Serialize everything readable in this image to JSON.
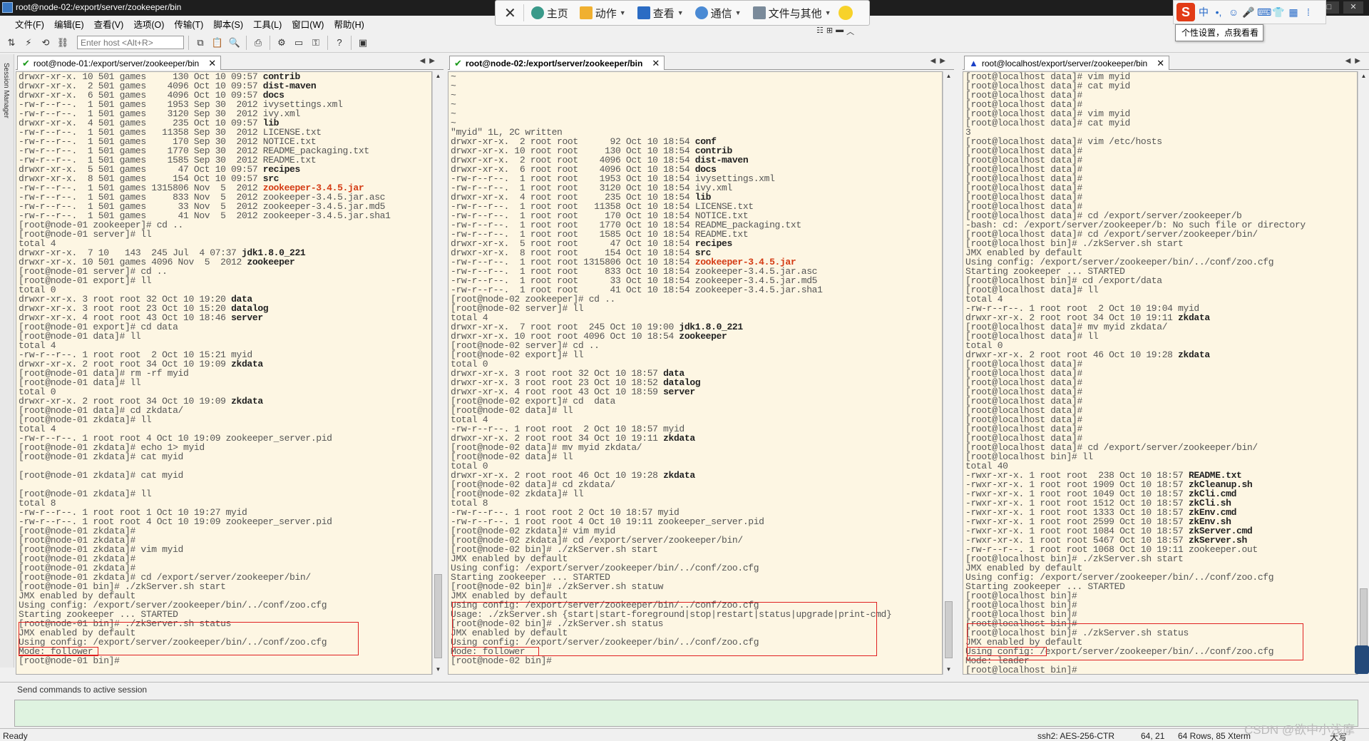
{
  "window": {
    "title": "root@node-02:/export/server/zookeeper/bin",
    "controls": [
      "—",
      "□",
      "✕"
    ]
  },
  "float_toolbar": {
    "close": "✕",
    "items": [
      {
        "label": "主页",
        "caret": false
      },
      {
        "label": "动作",
        "caret": true
      },
      {
        "label": "查看",
        "caret": true
      },
      {
        "label": "通信",
        "caret": true
      },
      {
        "label": "文件与其他",
        "caret": true
      }
    ],
    "mini_controls": [
      "☷",
      "⊞",
      "▬",
      "︿"
    ]
  },
  "ime": {
    "logo": "S",
    "lang": "中",
    "icons": [
      "•,",
      "☺",
      "🎤",
      "⌨",
      "👕",
      "▦",
      "⁞"
    ],
    "tooltip": "个性设置，点我看看"
  },
  "menu": [
    "文件(F)",
    "编辑(E)",
    "查看(V)",
    "选项(O)",
    "传输(T)",
    "脚本(S)",
    "工具(L)",
    "窗口(W)",
    "帮助(H)"
  ],
  "toolbar": {
    "host_placeholder": "Enter host <Alt+R>"
  },
  "session_manager": "Session Manager",
  "panes": [
    {
      "tab_label": "root@node-01:/export/server/zookeeper/bin",
      "tab_status": "connected",
      "lines": [
        "drwxr-xr-x. 10 501 games     130 Oct 10 09:57 [[contrib]]",
        "drwxr-xr-x.  2 501 games    4096 Oct 10 09:57 [[dist-maven]]",
        "drwxr-xr-x.  6 501 games    4096 Oct 10 09:57 [[docs]]",
        "-rw-r--r--.  1 501 games    1953 Sep 30  2012 ivysettings.xml",
        "-rw-r--r--.  1 501 games    3120 Sep 30  2012 ivy.xml",
        "drwxr-xr-x.  4 501 games     235 Oct 10 09:57 [[lib]]",
        "-rw-r--r--.  1 501 games   11358 Sep 30  2012 LICENSE.txt",
        "-rw-r--r--.  1 501 games     170 Sep 30  2012 NOTICE.txt",
        "-rw-r--r--.  1 501 games    1770 Sep 30  2012 README_packaging.txt",
        "-rw-r--r--.  1 501 games    1585 Sep 30  2012 README.txt",
        "drwxr-xr-x.  5 501 games      47 Oct 10 09:57 [[recipes]]",
        "drwxr-xr-x.  8 501 games     154 Oct 10 09:57 [[src]]",
        "-rw-r--r--.  1 501 games 1315806 Nov  5  2012 {{zookeeper-3.4.5.jar}}",
        "-rw-r--r--.  1 501 games     833 Nov  5  2012 zookeeper-3.4.5.jar.asc",
        "-rw-r--r--.  1 501 games      33 Nov  5  2012 zookeeper-3.4.5.jar.md5",
        "-rw-r--r--.  1 501 games      41 Nov  5  2012 zookeeper-3.4.5.jar.sha1",
        "[root@node-01 zookeeper]# cd ..",
        "[root@node-01 server]# ll",
        "total 4",
        "drwxr-xr-x.  7 10   143  245 Jul  4 07:37 [[jdk1.8.0_221]]",
        "drwxr-xr-x. 10 501 games 4096 Nov  5  2012 [[zookeeper]]",
        "[root@node-01 server]# cd ..",
        "[root@node-01 export]# ll",
        "total 0",
        "drwxr-xr-x. 3 root root 32 Oct 10 19:20 [[data]]",
        "drwxr-xr-x. 3 root root 23 Oct 10 15:20 [[datalog]]",
        "drwxr-xr-x. 4 root root 43 Oct 10 18:46 [[server]]",
        "[root@node-01 export]# cd data",
        "[root@node-01 data]# ll",
        "total 4",
        "-rw-r--r--. 1 root root  2 Oct 10 15:21 myid",
        "drwxr-xr-x. 2 root root 34 Oct 10 19:09 [[zkdata]]",
        "[root@node-01 data]# rm -rf myid",
        "[root@node-01 data]# ll",
        "total 0",
        "drwxr-xr-x. 2 root root 34 Oct 10 19:09 [[zkdata]]",
        "[root@node-01 data]# cd zkdata/",
        "[root@node-01 zkdata]# ll",
        "total 4",
        "-rw-r--r--. 1 root root 4 Oct 10 19:09 zookeeper_server.pid",
        "[root@node-01 zkdata]# echo 1> myid",
        "[root@node-01 zkdata]# cat myid",
        "",
        "[root@node-01 zkdata]# cat myid",
        "",
        "[root@node-01 zkdata]# ll",
        "total 8",
        "-rw-r--r--. 1 root root 1 Oct 10 19:27 myid",
        "-rw-r--r--. 1 root root 4 Oct 10 19:09 zookeeper_server.pid",
        "[root@node-01 zkdata]#",
        "[root@node-01 zkdata]#",
        "[root@node-01 zkdata]# vim myid",
        "[root@node-01 zkdata]#",
        "[root@node-01 zkdata]#",
        "[root@node-01 zkdata]# cd /export/server/zookeeper/bin/",
        "[root@node-01 bin]# ./zkServer.sh start",
        "JMX enabled by default",
        "Using config: /export/server/zookeeper/bin/../conf/zoo.cfg",
        "Starting zookeeper ... STARTED",
        "[root@node-01 bin]# ./zkServer.sh status",
        "JMX enabled by default",
        "Using config: /export/server/zookeeper/bin/../conf/zoo.cfg",
        "Mode: follower",
        "[root@node-01 bin]#"
      ]
    },
    {
      "tab_label": "root@node-02:/export/server/zookeeper/bin",
      "tab_status": "connected",
      "lines": [
        "~",
        "~",
        "~",
        "~",
        "~",
        "~",
        "\"myid\" 1L, 2C written",
        "drwxr-xr-x.  2 root root      92 Oct 10 18:54 [[conf]]",
        "drwxr-xr-x. 10 root root     130 Oct 10 18:54 [[contrib]]",
        "drwxr-xr-x.  2 root root    4096 Oct 10 18:54 [[dist-maven]]",
        "drwxr-xr-x.  6 root root    4096 Oct 10 18:54 [[docs]]",
        "-rw-r--r--.  1 root root    1953 Oct 10 18:54 ivysettings.xml",
        "-rw-r--r--.  1 root root    3120 Oct 10 18:54 ivy.xml",
        "drwxr-xr-x.  4 root root     235 Oct 10 18:54 [[lib]]",
        "-rw-r--r--.  1 root root   11358 Oct 10 18:54 LICENSE.txt",
        "-rw-r--r--.  1 root root     170 Oct 10 18:54 NOTICE.txt",
        "-rw-r--r--.  1 root root    1770 Oct 10 18:54 README_packaging.txt",
        "-rw-r--r--.  1 root root    1585 Oct 10 18:54 README.txt",
        "drwxr-xr-x.  5 root root      47 Oct 10 18:54 [[recipes]]",
        "drwxr-xr-x.  8 root root     154 Oct 10 18:54 [[src]]",
        "-rw-r--r--.  1 root root 1315806 Oct 10 18:54 {{zookeeper-3.4.5.jar}}",
        "-rw-r--r--.  1 root root     833 Oct 10 18:54 zookeeper-3.4.5.jar.asc",
        "-rw-r--r--.  1 root root      33 Oct 10 18:54 zookeeper-3.4.5.jar.md5",
        "-rw-r--r--.  1 root root      41 Oct 10 18:54 zookeeper-3.4.5.jar.sha1",
        "[root@node-02 zookeeper]# cd ..",
        "[root@node-02 server]# ll",
        "total 4",
        "drwxr-xr-x.  7 root root  245 Oct 10 19:00 [[jdk1.8.0_221]]",
        "drwxr-xr-x. 10 root root 4096 Oct 10 18:54 [[zookeeper]]",
        "[root@node-02 server]# cd ..",
        "[root@node-02 export]# ll",
        "total 0",
        "drwxr-xr-x. 3 root root 32 Oct 10 18:57 [[data]]",
        "drwxr-xr-x. 3 root root 23 Oct 10 18:52 [[datalog]]",
        "drwxr-xr-x. 4 root root 43 Oct 10 18:59 [[server]]",
        "[root@node-02 export]# cd  data",
        "[root@node-02 data]# ll",
        "total 4",
        "-rw-r--r--. 1 root root  2 Oct 10 18:57 myid",
        "drwxr-xr-x. 2 root root 34 Oct 10 19:11 [[zkdata]]",
        "[root@node-02 data]# mv myid zkdata/",
        "[root@node-02 data]# ll",
        "total 0",
        "drwxr-xr-x. 2 root root 46 Oct 10 19:28 [[zkdata]]",
        "[root@node-02 data]# cd zkdata/",
        "[root@node-02 zkdata]# ll",
        "total 8",
        "-rw-r--r--. 1 root root 2 Oct 10 18:57 myid",
        "-rw-r--r--. 1 root root 4 Oct 10 19:11 zookeeper_server.pid",
        "[root@node-02 zkdata]# vim myid",
        "[root@node-02 zkdata]# cd /export/server/zookeeper/bin/",
        "[root@node-02 bin]# ./zkServer.sh start",
        "JMX enabled by default",
        "Using config: /export/server/zookeeper/bin/../conf/zoo.cfg",
        "Starting zookeeper ... STARTED",
        "[root@node-02 bin]# ./zkServer.sh statuw",
        "JMX enabled by default",
        "Using config: /export/server/zookeeper/bin/../conf/zoo.cfg",
        "Usage: ./zkServer.sh {start|start-foreground|stop|restart|status|upgrade|print-cmd}",
        "[root@node-02 bin]# ./zkServer.sh status",
        "JMX enabled by default",
        "Using config: /export/server/zookeeper/bin/../conf/zoo.cfg",
        "Mode: follower",
        "[root@node-02 bin]#"
      ]
    },
    {
      "tab_label": "root@localhost/export/server/zookeeper/bin",
      "tab_status": "warning",
      "lines": [
        "[root@localhost data]# vim myid",
        "[root@localhost data]# cat myid",
        "[root@localhost data]#",
        "[root@localhost data]#",
        "[root@localhost data]# vim myid",
        "[root@localhost data]# cat myid",
        "3",
        "[root@localhost data]# vim /etc/hosts",
        "[root@localhost data]#",
        "[root@localhost data]#",
        "[root@localhost data]#",
        "[root@localhost data]#",
        "[root@localhost data]#",
        "[root@localhost data]#",
        "[root@localhost data]#",
        "[root@localhost data]# cd /export/server/zookeeper/b",
        "-bash: cd: /export/server/zookeeper/b: No such file or directory",
        "[root@localhost data]# cd /export/server/zookeeper/bin/",
        "[root@localhost bin]# ./zkServer.sh start",
        "JMX enabled by default",
        "Using config: /export/server/zookeeper/bin/../conf/zoo.cfg",
        "Starting zookeeper ... STARTED",
        "[root@localhost bin]# cd /export/data",
        "[root@localhost data]# ll",
        "total 4",
        "-rw-r--r--. 1 root root  2 Oct 10 19:04 myid",
        "drwxr-xr-x. 2 root root 34 Oct 10 19:11 [[zkdata]]",
        "[root@localhost data]# mv myid zkdata/",
        "[root@localhost data]# ll",
        "total 0",
        "drwxr-xr-x. 2 root root 46 Oct 10 19:28 [[zkdata]]",
        "[root@localhost data]#",
        "[root@localhost data]#",
        "[root@localhost data]#",
        "[root@localhost data]#",
        "[root@localhost data]#",
        "[root@localhost data]#",
        "[root@localhost data]#",
        "[root@localhost data]#",
        "[root@localhost data]#",
        "[root@localhost data]# cd /export/server/zookeeper/bin/",
        "[root@localhost bin]# ll",
        "total 40",
        "-rwxr-xr-x. 1 root root  238 Oct 10 18:57 [[README.txt]]",
        "-rwxr-xr-x. 1 root root 1909 Oct 10 18:57 [[zkCleanup.sh]]",
        "-rwxr-xr-x. 1 root root 1049 Oct 10 18:57 [[zkCli.cmd]]",
        "-rwxr-xr-x. 1 root root 1512 Oct 10 18:57 [[zkCli.sh]]",
        "-rwxr-xr-x. 1 root root 1333 Oct 10 18:57 [[zkEnv.cmd]]",
        "-rwxr-xr-x. 1 root root 2599 Oct 10 18:57 [[zkEnv.sh]]",
        "-rwxr-xr-x. 1 root root 1084 Oct 10 18:57 [[zkServer.cmd]]",
        "-rwxr-xr-x. 1 root root 5467 Oct 10 18:57 [[zkServer.sh]]",
        "-rw-r--r--. 1 root root 1068 Oct 10 19:11 zookeeper.out",
        "[root@localhost bin]# ./zkServer.sh start",
        "JMX enabled by default",
        "Using config: /export/server/zookeeper/bin/../conf/zoo.cfg",
        "Starting zookeeper ... STARTED",
        "[root@localhost bin]#",
        "[root@localhost bin]#",
        "[root@localhost bin]#",
        "[root@localhost bin]#",
        "[root@localhost bin]# ./zkServer.sh status",
        "JMX enabled by default",
        "Using config: /export/server/zookeeper/bin/../conf/zoo.cfg",
        "Mode: leader",
        "[root@localhost bin]#"
      ]
    }
  ],
  "send_commands": {
    "label": "Send commands to active session"
  },
  "statusbar": {
    "state": "Ready",
    "cipher": "ssh2: AES-256-CTR",
    "cursor": "64,  21",
    "dimensions": "64 Rows, 85 Xterm",
    "caps": "大写"
  },
  "watermark": "CSDN @欲中小浅摩",
  "colors": {
    "terminal_bg": "#fdf6e3",
    "highlight_file": "#d43a13",
    "annotation": "#e02020",
    "send_bar": "#dff3e0"
  }
}
